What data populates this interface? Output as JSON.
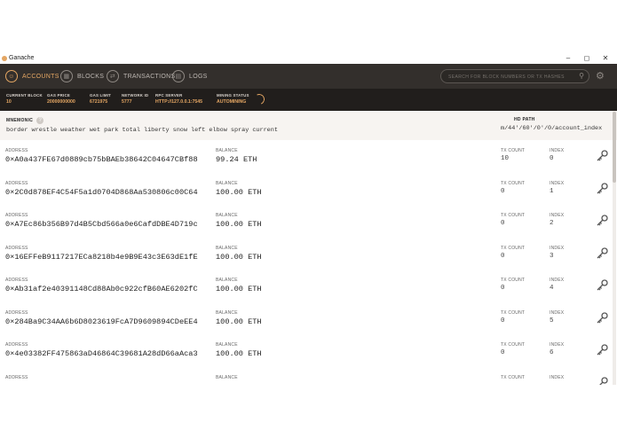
{
  "window": {
    "title": "Ganache",
    "controls": [
      "–",
      "◻",
      "✕"
    ]
  },
  "nav": {
    "tabs": [
      {
        "label": "ACCOUNTS",
        "icon": "account-icon",
        "glyph": "☺",
        "active": true
      },
      {
        "label": "BLOCKS",
        "icon": "blocks-icon",
        "glyph": "▦",
        "active": false
      },
      {
        "label": "TRANSACTIONS",
        "icon": "transactions-icon",
        "glyph": "⇄",
        "active": false
      },
      {
        "label": "LOGS",
        "icon": "logs-icon",
        "glyph": "▤",
        "active": false
      }
    ],
    "search_placeholder": "SEARCH FOR BLOCK NUMBERS OR TX HASHES",
    "search_icon": "⚲",
    "settings_icon": "⚙"
  },
  "status": {
    "current_block": {
      "label": "CURRENT BLOCK",
      "value": "10"
    },
    "gas_price": {
      "label": "GAS PRICE",
      "value": "20000000000"
    },
    "gas_limit": {
      "label": "GAS LIMIT",
      "value": "6721975"
    },
    "network_id": {
      "label": "NETWORK ID",
      "value": "5777"
    },
    "rpc_server": {
      "label": "RPC SERVER",
      "value": "HTTP://127.0.0.1:7545"
    },
    "mining_status": {
      "label": "MINING STATUS",
      "value": "AUTOMINING"
    }
  },
  "mnemonic": {
    "label": "MNEMONIC",
    "help_icon": "?",
    "value": "border wrestle weather wet park total liberty snow left elbow spray current",
    "hd_path_label": "HD PATH",
    "hd_path_value": "m/44'/60'/0'/0/account_index"
  },
  "columns": {
    "address": "ADDRESS",
    "balance": "BALANCE",
    "tx_count": "TX COUNT",
    "index": "INDEX"
  },
  "accounts": [
    {
      "address": "0×A0a437FE67d0889cb75bBAEb38642C04647CBf88",
      "balance": "99.24 ETH",
      "tx_count": "10",
      "index": "0"
    },
    {
      "address": "0×2C0d878EF4C54F5a1d0704D868Aa530806c00C64",
      "balance": "100.00 ETH",
      "tx_count": "0",
      "index": "1"
    },
    {
      "address": "0×A7Ec86b356B97d4B5Cbd566a0e6CafdDBE4D719c",
      "balance": "100.00 ETH",
      "tx_count": "0",
      "index": "2"
    },
    {
      "address": "0×16EFFeB9117217ECa8218b4e9B9E43c3E63dE1fE",
      "balance": "100.00 ETH",
      "tx_count": "0",
      "index": "3"
    },
    {
      "address": "0×Ab31af2e40391148Cd88Ab0c922cfB60AE6202fC",
      "balance": "100.00 ETH",
      "tx_count": "0",
      "index": "4"
    },
    {
      "address": "0×284Ba9C34AA6b6D8023619FcA7D9609894CDeEE4",
      "balance": "100.00 ETH",
      "tx_count": "0",
      "index": "5"
    },
    {
      "address": "0×4e03382FF475863aD46864C39681A28dD66aAca3",
      "balance": "100.00 ETH",
      "tx_count": "0",
      "index": "6"
    },
    {
      "address": "",
      "balance": "",
      "tx_count": "",
      "index": ""
    }
  ],
  "colors": {
    "accent": "#e4a663",
    "navbar": "#332f2c",
    "statusbar": "#211e1c"
  }
}
